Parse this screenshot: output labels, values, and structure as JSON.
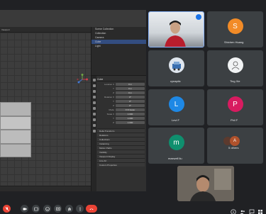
{
  "blender": {
    "header_label": "Viewport",
    "outliner_rows": [
      "Scene Collection",
      "Collection",
      "Camera",
      "Cube",
      "Light"
    ],
    "properties_title": "Cube",
    "fields": [
      {
        "label": "Location X",
        "value": "0 m"
      },
      {
        "label": "Y",
        "value": "0 m"
      },
      {
        "label": "Z",
        "value": "0 m"
      },
      {
        "label": "Rotation X",
        "value": "0°"
      },
      {
        "label": "Y",
        "value": "0°"
      },
      {
        "label": "Z",
        "value": "0°"
      },
      {
        "label": "Mode",
        "value": "XYZ Euler"
      },
      {
        "label": "Scale X",
        "value": "1.000"
      },
      {
        "label": "Y",
        "value": "1.000"
      },
      {
        "label": "Z",
        "value": "1.000"
      }
    ],
    "panels": [
      "Delta Transform",
      "Relations",
      "Collections",
      "Instancing",
      "Motion Paths",
      "Visibility",
      "Viewport Display",
      "Line Art",
      "Custom Properties"
    ]
  },
  "participants": [
    {
      "name": "Shichen Huang",
      "initial": "S",
      "color": "#f28b27"
    },
    {
      "name": "cynaptic",
      "initial": "",
      "color": "#5f6368"
    },
    {
      "name": "Ting Xie",
      "initial": "",
      "color": "#f1f3f4"
    },
    {
      "name": "Levi F",
      "initial": "L",
      "color": "#1e88e5"
    },
    {
      "name": "Phil F",
      "initial": "P",
      "color": "#d81b60"
    },
    {
      "name": "maxwell liu",
      "initial": "m",
      "color": "#0f8f6e"
    },
    {
      "name": "5 others",
      "initial": "A",
      "color": "#b0522c"
    }
  ],
  "icons": {
    "mic": "mic-off-icon",
    "camera": "camera-icon",
    "captions": "captions-icon",
    "present": "present-icon",
    "reactions": "emoji-icon",
    "raise_hand": "hand-icon",
    "more": "more-icon",
    "end": "end-call-icon",
    "info": "info-icon",
    "people": "people-icon",
    "chat": "chat-icon",
    "activities": "activities-icon"
  }
}
